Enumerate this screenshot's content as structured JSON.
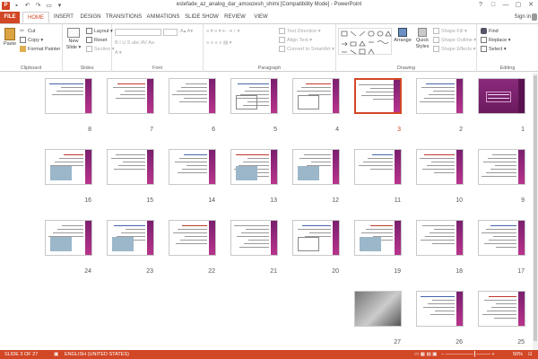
{
  "app": {
    "title": "estefade_az_analog_dar_amoozesh_shimi [Compatibility Mode] - PowerPoint",
    "sign_in": "Sign in",
    "window_controls": [
      "?",
      "□",
      "—",
      "▢",
      "✕"
    ]
  },
  "tabs": [
    "FILE",
    "HOME",
    "INSERT",
    "DESIGN",
    "TRANSITIONS",
    "ANIMATIONS",
    "SLIDE SHOW",
    "REVIEW",
    "VIEW"
  ],
  "active_tab": "HOME",
  "ribbon": {
    "clipboard": {
      "label": "Clipboard",
      "paste": "Paste",
      "cut": "Cut",
      "copy": "Copy",
      "format_painter": "Format Painter"
    },
    "slides": {
      "label": "Slides",
      "new_slide": "New Slide",
      "layout": "Layout",
      "reset": "Reset",
      "section": "Section"
    },
    "font": {
      "label": "Font"
    },
    "paragraph": {
      "label": "Paragraph",
      "text_direction": "Text Direction",
      "align_text": "Align Text",
      "convert_smartart": "Convert to SmartArt"
    },
    "drawing": {
      "label": "Drawing",
      "arrange": "Arrange",
      "quick_styles": "Quick Styles",
      "shape_fill": "Shape Fill",
      "shape_outline": "Shape Outline",
      "shape_effects": "Shape Effects"
    },
    "editing": {
      "label": "Editing",
      "find": "Find",
      "replace": "Replace",
      "select": "Select"
    }
  },
  "slides": [
    {
      "num": "1",
      "type": "title"
    },
    {
      "num": "2",
      "type": "text"
    },
    {
      "num": "3",
      "type": "text",
      "selected": true
    },
    {
      "num": "4",
      "type": "diagram"
    },
    {
      "num": "5",
      "type": "diagram"
    },
    {
      "num": "6",
      "type": "text"
    },
    {
      "num": "7",
      "type": "text"
    },
    {
      "num": "8",
      "type": "text"
    },
    {
      "num": "9",
      "type": "text"
    },
    {
      "num": "10",
      "type": "text"
    },
    {
      "num": "11",
      "type": "text"
    },
    {
      "num": "12",
      "type": "picture"
    },
    {
      "num": "13",
      "type": "picture"
    },
    {
      "num": "14",
      "type": "text"
    },
    {
      "num": "15",
      "type": "text"
    },
    {
      "num": "16",
      "type": "picture"
    },
    {
      "num": "17",
      "type": "text"
    },
    {
      "num": "18",
      "type": "text"
    },
    {
      "num": "19",
      "type": "picture"
    },
    {
      "num": "20",
      "type": "diagram"
    },
    {
      "num": "21",
      "type": "text"
    },
    {
      "num": "22",
      "type": "text"
    },
    {
      "num": "23",
      "type": "picture"
    },
    {
      "num": "24",
      "type": "picture"
    },
    {
      "num": "25",
      "type": "text"
    },
    {
      "num": "26",
      "type": "text"
    },
    {
      "num": "27",
      "type": "photo"
    }
  ],
  "status": {
    "slide_of": "SLIDE 3 OF 27",
    "language": "ENGLISH (UNITED STATES)",
    "zoom": "50%"
  },
  "colors": {
    "accent": "#d24726",
    "slide_band": "#8b2a7c"
  }
}
